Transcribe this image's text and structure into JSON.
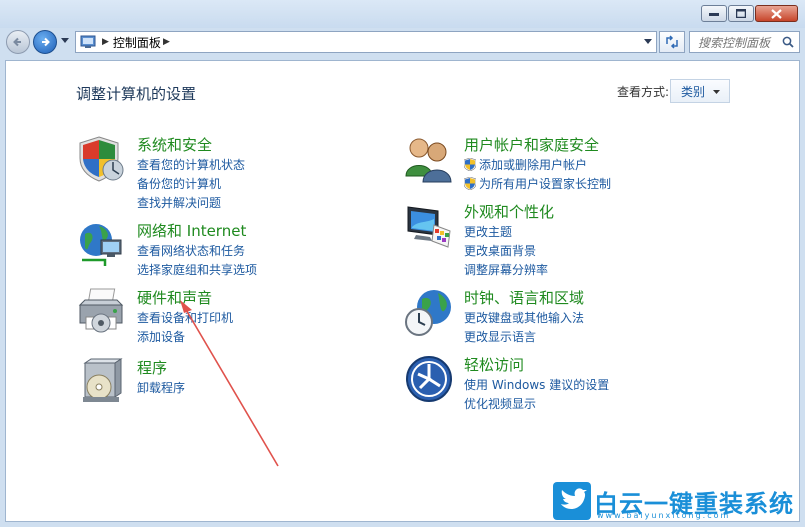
{
  "window": {
    "address": {
      "crumb": "控制面板"
    },
    "search": {
      "placeholder": "搜索控制面板"
    }
  },
  "page": {
    "title": "调整计算机的设置",
    "view_by_label": "查看方式:",
    "view_by_value": "类别"
  },
  "categories": [
    {
      "title": "系统和安全",
      "icon": "shield-icon",
      "links": [
        "查看您的计算机状态",
        "备份您的计算机",
        "查找并解决问题"
      ]
    },
    {
      "title": "网络和 Internet",
      "icon": "network-globe-icon",
      "links": [
        "查看网络状态和任务",
        "选择家庭组和共享选项"
      ]
    },
    {
      "title": "硬件和声音",
      "icon": "printer-icon",
      "links": [
        "查看设备和打印机",
        "添加设备"
      ]
    },
    {
      "title": "程序",
      "icon": "programs-box-icon",
      "links": [
        "卸载程序"
      ]
    },
    {
      "title": "用户帐户和家庭安全",
      "icon": "users-icon",
      "links": [
        "添加或删除用户帐户",
        "为所有用户设置家长控制"
      ]
    },
    {
      "title": "外观和个性化",
      "icon": "monitor-paint-icon",
      "links": [
        "更改主题",
        "更改桌面背景",
        "调整屏幕分辨率"
      ]
    },
    {
      "title": "时钟、语言和区域",
      "icon": "globe-clock-icon",
      "links": [
        "更改键盘或其他输入法",
        "更改显示语言"
      ]
    },
    {
      "title": "轻松访问",
      "icon": "ease-of-access-icon",
      "links": [
        "使用 Windows 建议的设置",
        "优化视频显示"
      ]
    }
  ],
  "watermark": {
    "text": "白云一键重装系统",
    "url": "www.baiyunxitong.com"
  },
  "colors": {
    "category_title": "#1f8a1f",
    "link": "#1e5aa0",
    "annotation_arrow": "#e0524c"
  }
}
